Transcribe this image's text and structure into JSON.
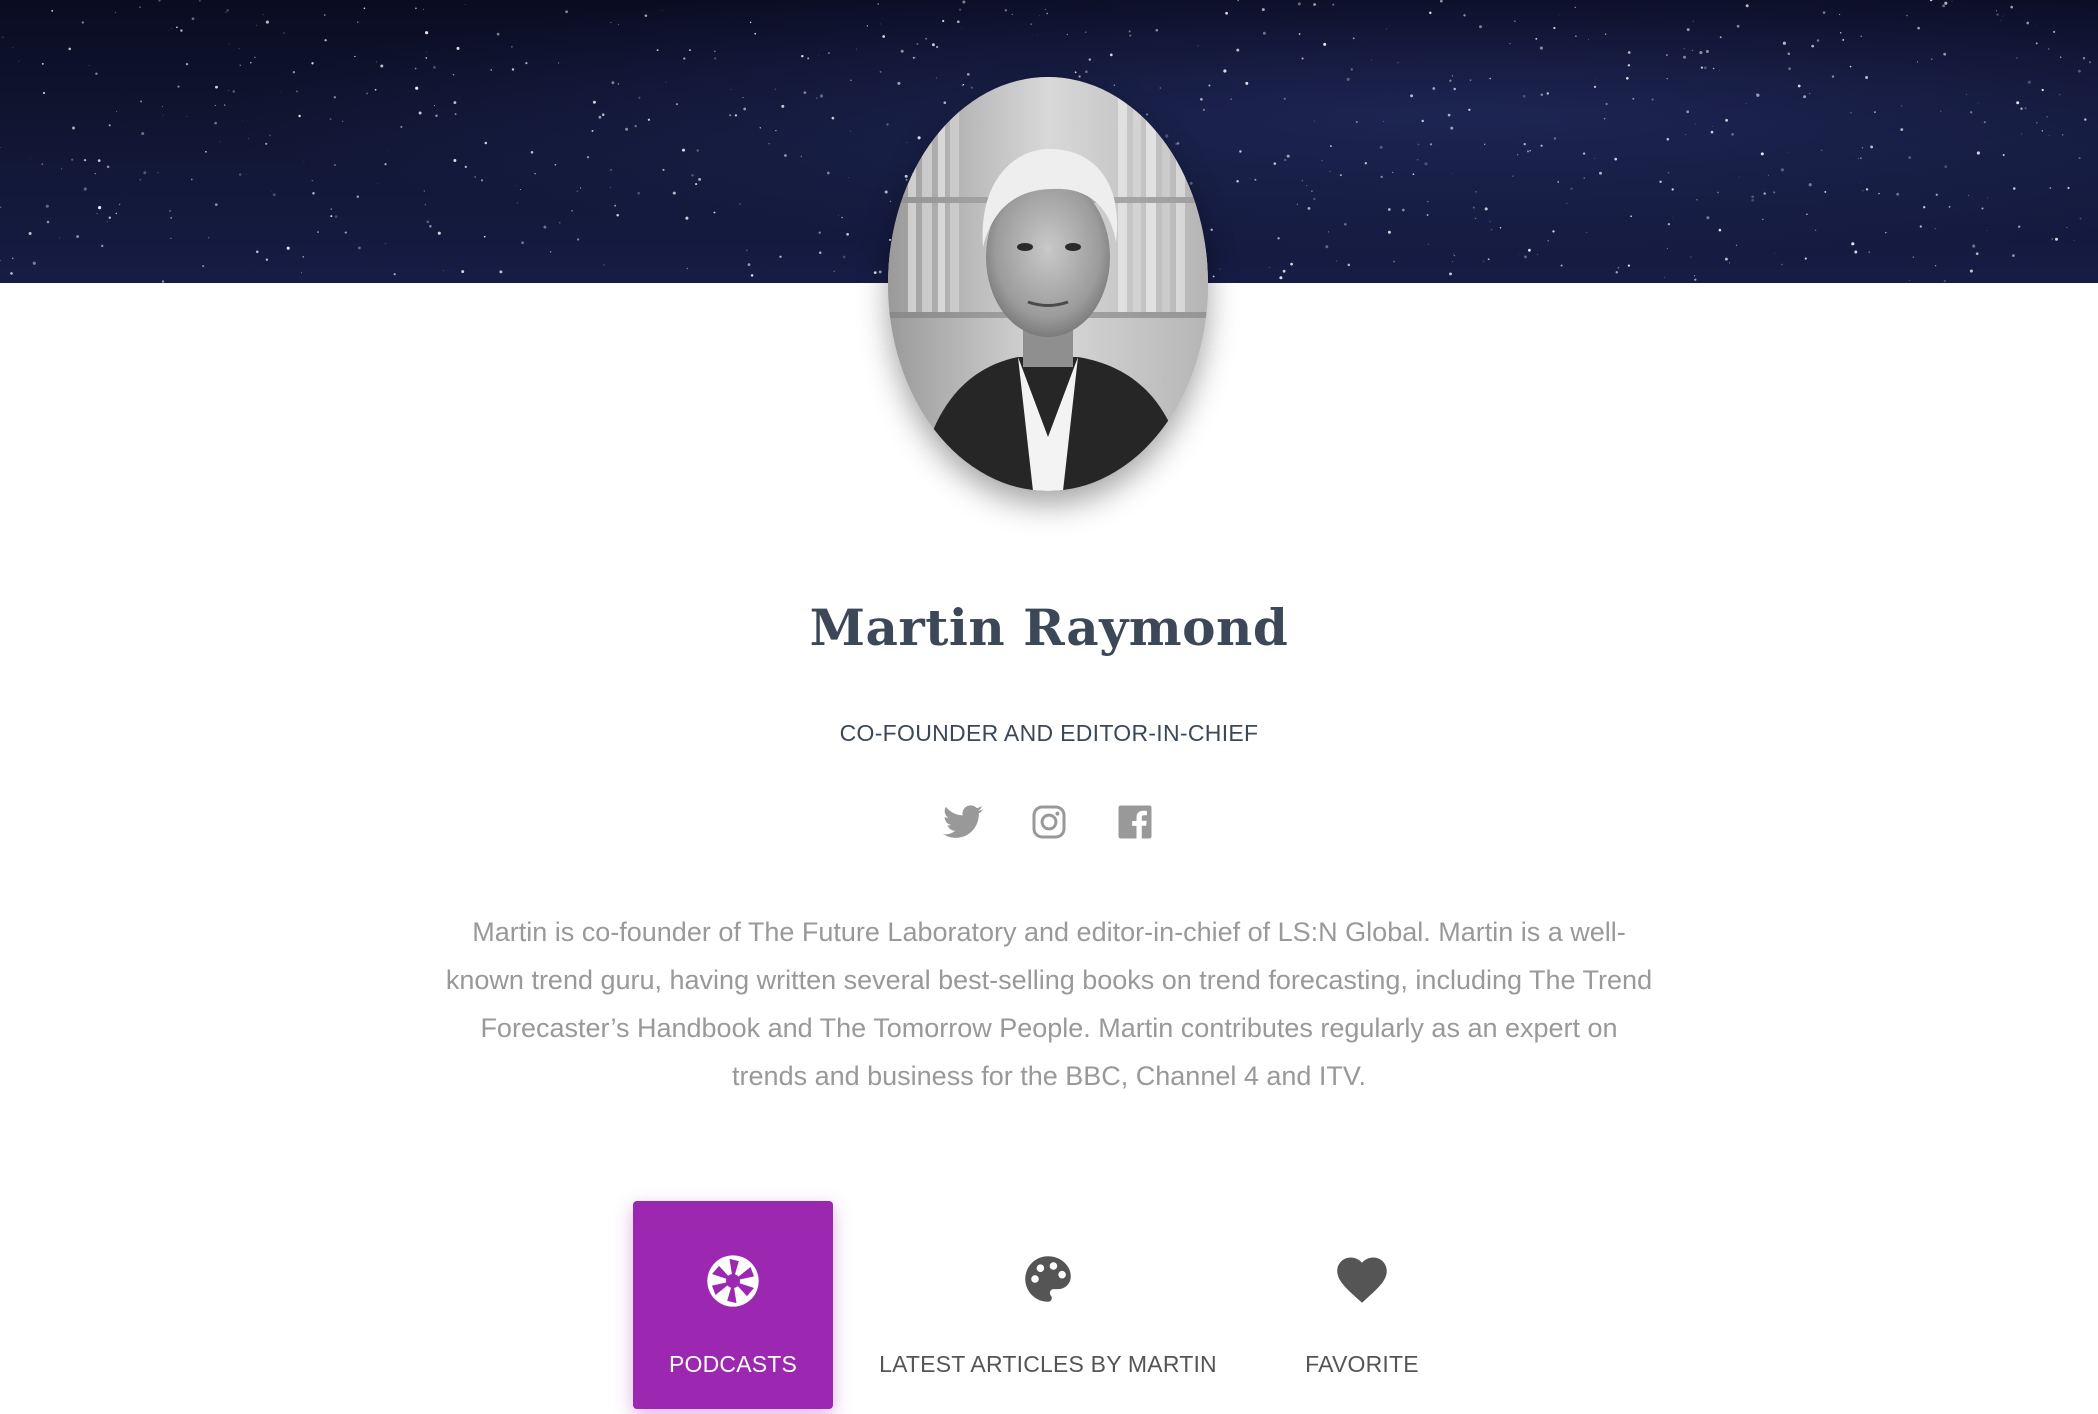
{
  "profile": {
    "name": "Martin Raymond",
    "title": "CO-FOUNDER AND EDITOR-IN-CHIEF",
    "bio": "Martin is co-founder of The Future Laboratory and editor-in-chief of LS:N Global. Martin is a well-known trend guru, having written several best-selling books on trend forecasting, including The Trend Forecaster’s Handbook and The Tomorrow People. Martin contributes regularly as an expert on trends and business for the BBC, Channel 4 and ITV."
  },
  "social": [
    {
      "icon": "twitter-icon",
      "color": "#999999"
    },
    {
      "icon": "instagram-icon",
      "color": "#999999"
    },
    {
      "icon": "facebook-icon",
      "color": "#999999"
    }
  ],
  "tabs": [
    {
      "label": "PODCASTS",
      "icon": "camera-aperture-icon",
      "active": true
    },
    {
      "label": "LATEST ARTICLES BY MARTIN",
      "icon": "palette-icon",
      "active": false
    },
    {
      "label": "FAVORITE",
      "icon": "heart-icon",
      "active": false
    }
  ],
  "colors": {
    "accent": "#9c27b0",
    "heading": "#3c4858",
    "muted": "#999999",
    "banner": "#0a0c22"
  }
}
